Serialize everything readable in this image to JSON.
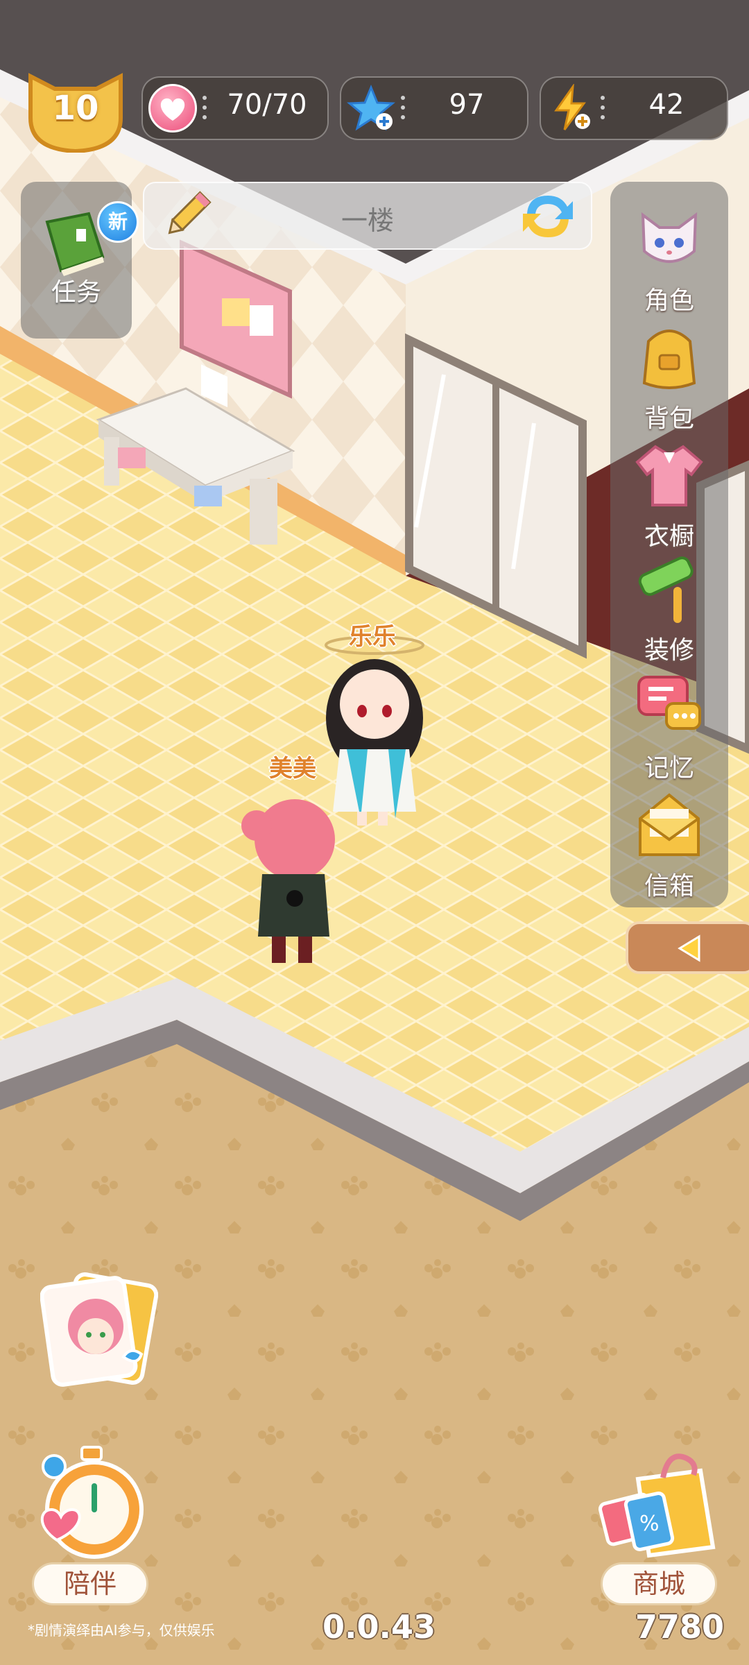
{
  "hud": {
    "level": "10",
    "hearts": "70/70",
    "stars": "97",
    "energy": "42",
    "icons": {
      "hearts": "heart-icon",
      "stars": "star-plus-icon",
      "energy": "lightning-plus-icon"
    }
  },
  "floor_bar": {
    "title": "一楼",
    "edit_icon": "pencil-icon",
    "switch_icon": "swap-arrows-icon"
  },
  "task": {
    "label": "任务",
    "badge": "新"
  },
  "side_menu": {
    "items": [
      {
        "label": "角色",
        "icon": "fox-character-icon"
      },
      {
        "label": "背包",
        "icon": "backpack-icon"
      },
      {
        "label": "衣橱",
        "icon": "shirt-icon"
      },
      {
        "label": "装修",
        "icon": "paint-roller-icon"
      },
      {
        "label": "记忆",
        "icon": "chat-bubbles-icon"
      },
      {
        "label": "信箱",
        "icon": "mail-envelope-icon"
      }
    ],
    "collapse_icon": "left-arrow-icon"
  },
  "characters": [
    {
      "name": "乐乐"
    },
    {
      "name": "美美"
    }
  ],
  "bottom": {
    "companion_label": "陪伴",
    "shop_label": "商城",
    "disclaimer": "*剧情演绎由AI参与，仅供娱乐",
    "version": "0.0.43",
    "score": "7780"
  },
  "colors": {
    "floor": "#fbe9a8",
    "carpet": "#d9b784",
    "wall": "#f7efe2",
    "accent": "#e0822c"
  }
}
